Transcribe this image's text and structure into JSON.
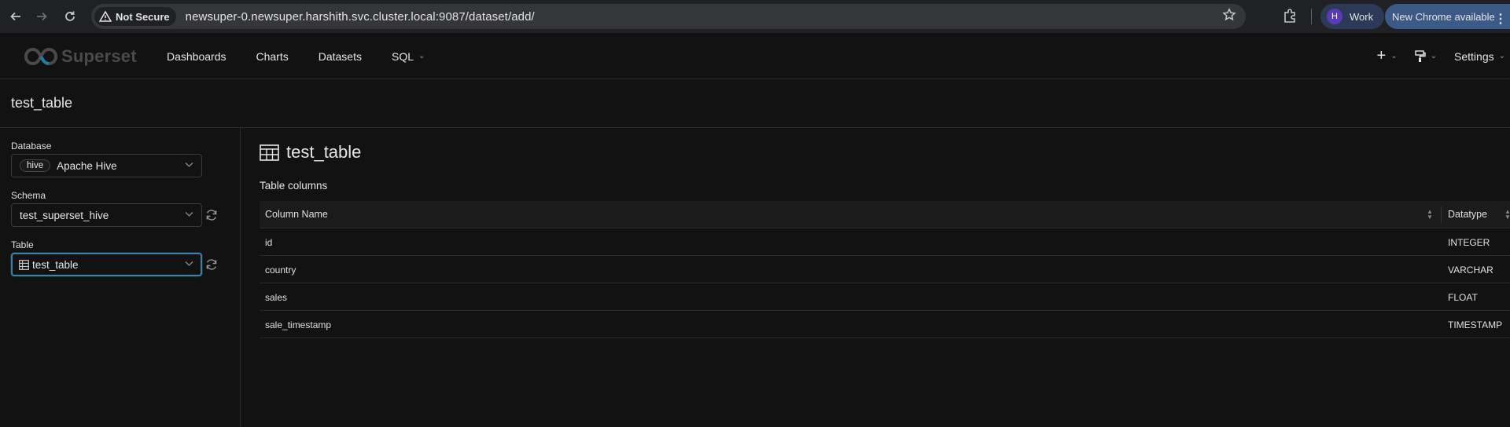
{
  "browser": {
    "not_secure_label": "Not Secure",
    "url": "newsuper-0.newsuper.harshith.svc.cluster.local:9087/dataset/add/",
    "profile_initial": "H",
    "profile_label": "Work",
    "update_label": "New Chrome available"
  },
  "header": {
    "logo_text": "Superset",
    "nav": [
      {
        "label": "Dashboards"
      },
      {
        "label": "Charts"
      },
      {
        "label": "Datasets"
      },
      {
        "label": "SQL"
      }
    ],
    "settings_label": "Settings"
  },
  "page": {
    "title": "test_table"
  },
  "form": {
    "database_label": "Database",
    "database_tag": "hive",
    "database_value": "Apache Hive",
    "schema_label": "Schema",
    "schema_value": "test_superset_hive",
    "table_label": "Table",
    "table_value": "test_table"
  },
  "content": {
    "title": "test_table",
    "section_label": "Table columns",
    "columns_header": [
      "Column Name",
      "Datatype"
    ],
    "rows": [
      {
        "name": "id",
        "type": "INTEGER"
      },
      {
        "name": "country",
        "type": "VARCHAR"
      },
      {
        "name": "sales",
        "type": "FLOAT"
      },
      {
        "name": "sale_timestamp",
        "type": "TIMESTAMP"
      }
    ]
  },
  "colors": {
    "background": "#121212",
    "focus_border": "#3f7fa8",
    "update_chip": "#3c5a88",
    "profile_chip": "#2c3a57"
  }
}
